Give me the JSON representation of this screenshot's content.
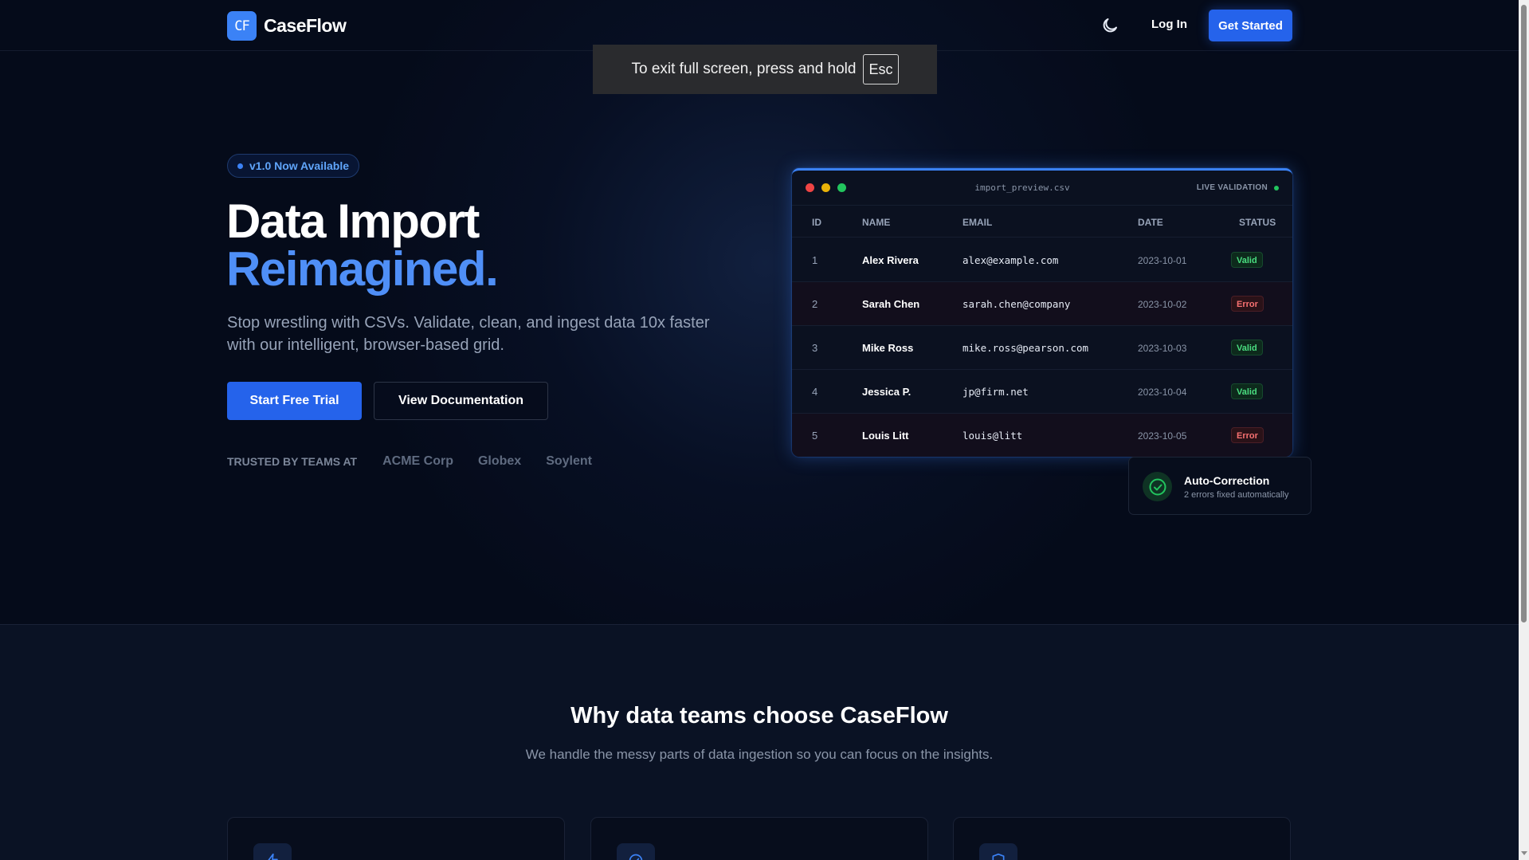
{
  "header": {
    "logo_mark": "CF",
    "brand": "CaseFlow",
    "theme_icon": "moon-icon",
    "login_label": "Log In",
    "cta_label": "Get Started"
  },
  "fullscreen_notice": {
    "text": "To exit full screen, press and hold",
    "key": "Esc"
  },
  "hero": {
    "badge": "v1.0 Now Available",
    "title_line1": "Data Import",
    "title_line2": "Reimagined.",
    "subtitle": "Stop wrestling with CSVs. Validate, clean, and ingest data 10x faster with our intelligent, browser-based grid.",
    "primary_cta": "Start Free Trial",
    "secondary_cta": "View Documentation",
    "trusted_label": "TRUSTED BY TEAMS AT",
    "trusted_companies": [
      "ACME Corp",
      "Globex",
      "Soylent"
    ]
  },
  "preview": {
    "filename": "import_preview.csv",
    "live_label": "LIVE VALIDATION",
    "columns": [
      "ID",
      "NAME",
      "EMAIL",
      "DATE",
      "STATUS"
    ],
    "rows": [
      {
        "id": "1",
        "name": "Alex Rivera",
        "email": "alex@example.com",
        "date": "2023-10-01",
        "status": "Valid"
      },
      {
        "id": "2",
        "name": "Sarah Chen",
        "email": "sarah.chen@company",
        "date": "2023-10-02",
        "status": "Error"
      },
      {
        "id": "3",
        "name": "Mike Ross",
        "email": "mike.ross@pearson.com",
        "date": "2023-10-03",
        "status": "Valid"
      },
      {
        "id": "4",
        "name": "Jessica P.",
        "email": "jp@firm.net",
        "date": "2023-10-04",
        "status": "Valid"
      },
      {
        "id": "5",
        "name": "Louis Litt",
        "email": "louis@litt",
        "date": "2023-10-05",
        "status": "Error"
      }
    ]
  },
  "auto_correction": {
    "title": "Auto-Correction",
    "subtitle": "2 errors fixed automatically"
  },
  "features": {
    "title": "Why data teams choose CaseFlow",
    "subtitle": "We handle the messy parts of data ingestion so you can focus on the insights.",
    "card_icons": [
      "lightning-icon",
      "check-circle-icon",
      "shield-icon"
    ]
  },
  "colors": {
    "accent": "#3b82f6",
    "valid": "#4ade80",
    "error": "#f87171",
    "background": "#050b1a"
  }
}
